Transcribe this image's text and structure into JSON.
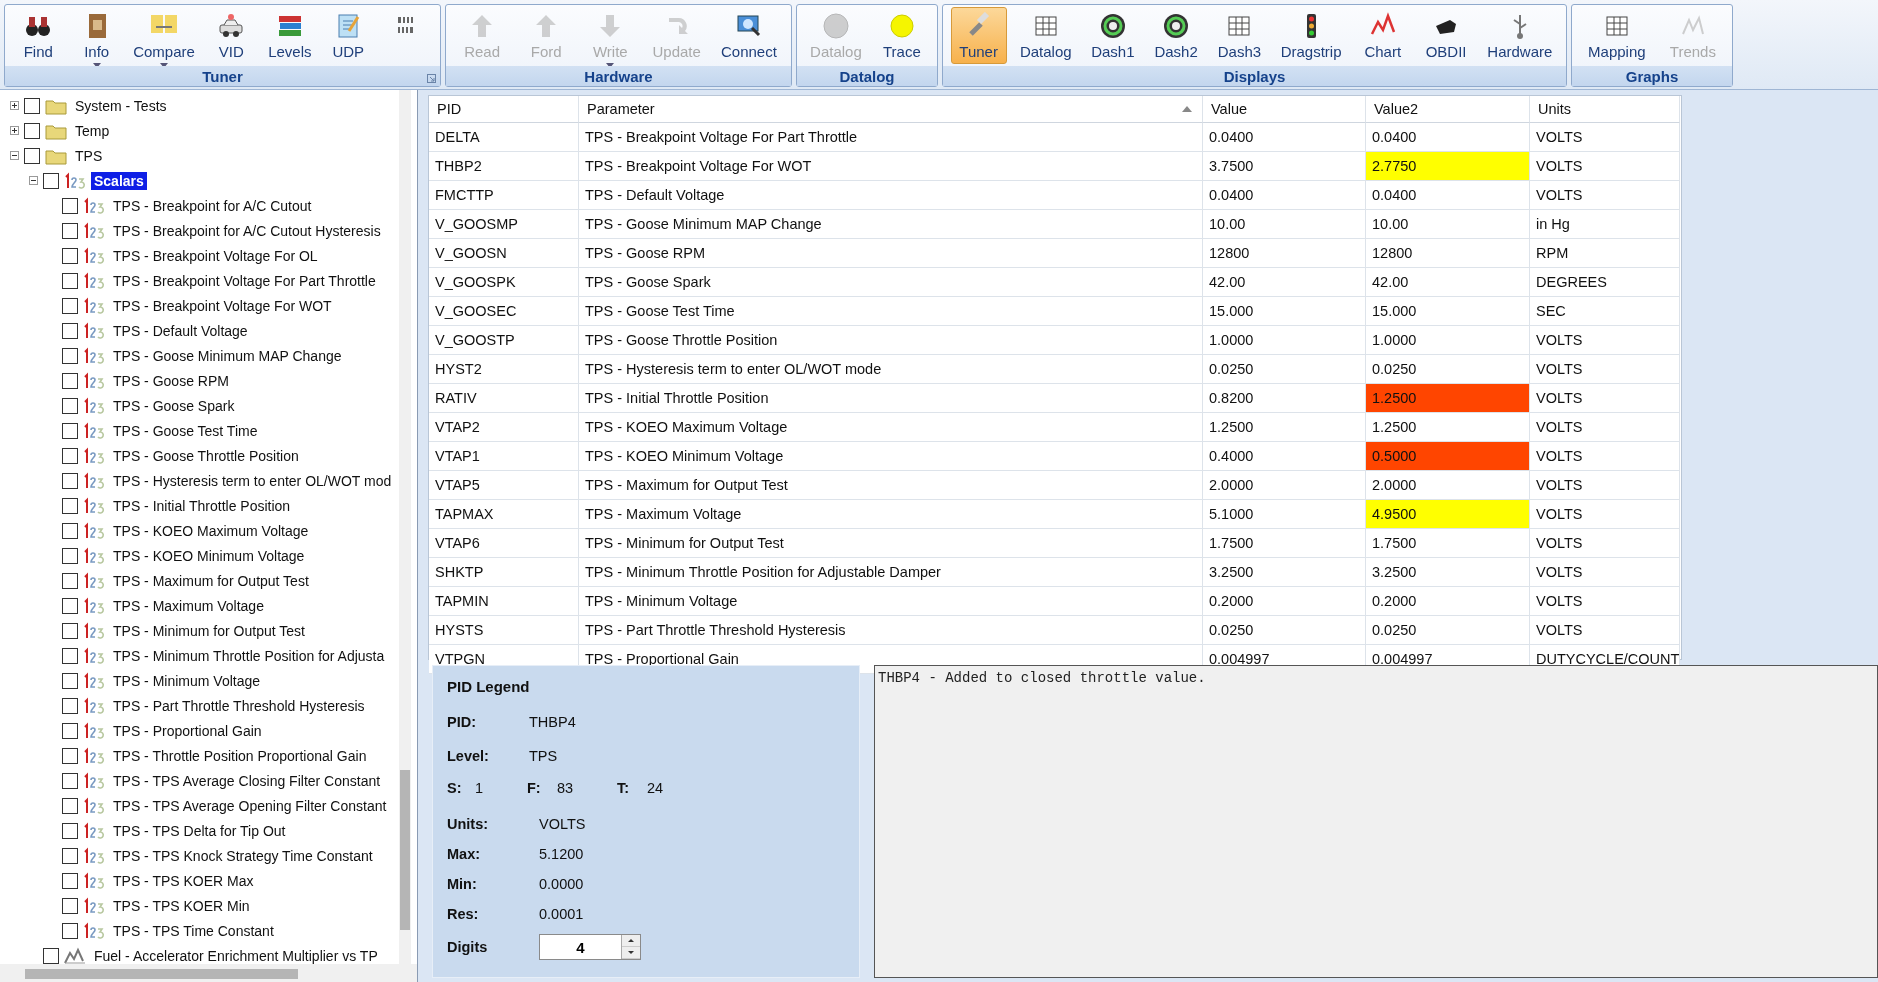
{
  "toolbar": {
    "groups": [
      {
        "title": "Tuner",
        "dialog_launcher": true,
        "buttons": [
          {
            "label": "Find",
            "disabled": false,
            "selected": false,
            "dropdown": false
          },
          {
            "label": "Info",
            "disabled": false,
            "selected": false,
            "dropdown": true
          },
          {
            "label": "Compare",
            "disabled": false,
            "selected": false,
            "dropdown": true
          },
          {
            "label": "VID",
            "disabled": false,
            "selected": false,
            "dropdown": false
          },
          {
            "label": "Levels",
            "disabled": false,
            "selected": false,
            "dropdown": false
          },
          {
            "label": "UDP",
            "disabled": false,
            "selected": false,
            "dropdown": false
          },
          {
            "disabled": false,
            "selected": false,
            "dropdown": false
          }
        ]
      },
      {
        "title": "Hardware",
        "dialog_launcher": false,
        "buttons": [
          {
            "label": "Read",
            "disabled": true,
            "selected": false,
            "dropdown": false
          },
          {
            "label": "Ford",
            "disabled": true,
            "selected": false,
            "dropdown": false
          },
          {
            "label": "Write",
            "disabled": true,
            "selected": false,
            "dropdown": true
          },
          {
            "label": "Update",
            "disabled": true,
            "selected": false,
            "dropdown": false
          },
          {
            "label": "Connect",
            "disabled": false,
            "selected": false,
            "dropdown": false
          }
        ]
      },
      {
        "title": "Datalog",
        "dialog_launcher": false,
        "buttons": [
          {
            "label": "Datalog",
            "disabled": true,
            "selected": false,
            "dropdown": false
          },
          {
            "label": "Trace",
            "disabled": false,
            "selected": false,
            "dropdown": false
          }
        ]
      },
      {
        "title": "Displays",
        "dialog_launcher": false,
        "buttons": [
          {
            "label": "Tuner",
            "disabled": false,
            "selected": true,
            "dropdown": false
          },
          {
            "label": "Datalog",
            "disabled": false,
            "selected": false,
            "dropdown": false
          },
          {
            "label": "Dash1",
            "disabled": false,
            "selected": false,
            "dropdown": false
          },
          {
            "label": "Dash2",
            "disabled": false,
            "selected": false,
            "dropdown": false
          },
          {
            "label": "Dash3",
            "disabled": false,
            "selected": false,
            "dropdown": false
          },
          {
            "label": "Dragstrip",
            "disabled": false,
            "selected": false,
            "dropdown": false
          },
          {
            "label": "Chart",
            "disabled": false,
            "selected": false,
            "dropdown": false
          },
          {
            "label": "OBDII",
            "disabled": false,
            "selected": false,
            "dropdown": false
          },
          {
            "label": "Hardware",
            "disabled": false,
            "selected": false,
            "dropdown": false
          }
        ]
      },
      {
        "title": "Graphs",
        "dialog_launcher": false,
        "buttons": [
          {
            "label": "Mapping",
            "disabled": false,
            "selected": false,
            "dropdown": false
          },
          {
            "label": "Trends",
            "disabled": true,
            "selected": false,
            "dropdown": false
          }
        ]
      }
    ]
  },
  "tree": {
    "items": [
      {
        "label": "System - Tests",
        "kind": "folder",
        "checked": false,
        "selected": false,
        "expanded": false
      },
      {
        "label": "Temp",
        "kind": "folder",
        "checked": false,
        "selected": false,
        "expanded": false
      },
      {
        "label": "TPS",
        "kind": "folder",
        "checked": false,
        "selected": false,
        "expanded": true,
        "children": [
          {
            "label": "Scalars",
            "kind": "number",
            "checked": false,
            "selected": true,
            "expanded": true,
            "children": [
              {
                "label": "TPS - Breakpoint for A/C Cutout",
                "kind": "number",
                "checked": false,
                "selected": false
              },
              {
                "label": "TPS - Breakpoint for A/C Cutout Hysteresis",
                "kind": "number",
                "checked": false,
                "selected": false
              },
              {
                "label": "TPS - Breakpoint Voltage For OL",
                "kind": "number",
                "checked": false,
                "selected": false
              },
              {
                "label": "TPS - Breakpoint Voltage For Part Throttle",
                "kind": "number",
                "checked": false,
                "selected": false
              },
              {
                "label": "TPS - Breakpoint Voltage For WOT",
                "kind": "number",
                "checked": false,
                "selected": false
              },
              {
                "label": "TPS - Default Voltage",
                "kind": "number",
                "checked": false,
                "selected": false
              },
              {
                "label": "TPS - Goose Minimum MAP Change",
                "kind": "number",
                "checked": false,
                "selected": false
              },
              {
                "label": "TPS - Goose RPM",
                "kind": "number",
                "checked": false,
                "selected": false
              },
              {
                "label": "TPS - Goose Spark",
                "kind": "number",
                "checked": false,
                "selected": false
              },
              {
                "label": "TPS - Goose Test Time",
                "kind": "number",
                "checked": false,
                "selected": false
              },
              {
                "label": "TPS - Goose Throttle Position",
                "kind": "number",
                "checked": false,
                "selected": false
              },
              {
                "label": "TPS - Hysteresis term to enter OL/WOT mod",
                "kind": "number",
                "checked": false,
                "selected": false
              },
              {
                "label": "TPS - Initial Throttle Position",
                "kind": "number",
                "checked": false,
                "selected": false
              },
              {
                "label": "TPS - KOEO Maximum Voltage",
                "kind": "number",
                "checked": false,
                "selected": false
              },
              {
                "label": "TPS - KOEO Minimum Voltage",
                "kind": "number",
                "checked": false,
                "selected": false
              },
              {
                "label": "TPS - Maximum for Output Test",
                "kind": "number",
                "checked": false,
                "selected": false
              },
              {
                "label": "TPS - Maximum Voltage",
                "kind": "number",
                "checked": false,
                "selected": false
              },
              {
                "label": "TPS - Minimum for Output Test",
                "kind": "number",
                "checked": false,
                "selected": false
              },
              {
                "label": "TPS - Minimum Throttle Position for Adjusta",
                "kind": "number",
                "checked": false,
                "selected": false
              },
              {
                "label": "TPS - Minimum Voltage",
                "kind": "number",
                "checked": false,
                "selected": false
              },
              {
                "label": "TPS - Part Throttle Threshold Hysteresis",
                "kind": "number",
                "checked": false,
                "selected": false
              },
              {
                "label": "TPS - Proportional Gain",
                "kind": "number",
                "checked": false,
                "selected": false
              },
              {
                "label": "TPS - Throttle Position Proportional Gain",
                "kind": "number",
                "checked": false,
                "selected": false
              },
              {
                "label": "TPS - TPS Average Closing Filter Constant",
                "kind": "number",
                "checked": false,
                "selected": false
              },
              {
                "label": "TPS - TPS Average Opening Filter Constant",
                "kind": "number",
                "checked": false,
                "selected": false
              },
              {
                "label": "TPS - TPS Delta for Tip Out",
                "kind": "number",
                "checked": false,
                "selected": false
              },
              {
                "label": "TPS - TPS Knock Strategy Time Constant",
                "kind": "number",
                "checked": false,
                "selected": false
              },
              {
                "label": "TPS - TPS KOER Max",
                "kind": "number",
                "checked": false,
                "selected": false
              },
              {
                "label": "TPS - TPS KOER Min",
                "kind": "number",
                "checked": false,
                "selected": false
              },
              {
                "label": "TPS - TPS Time Constant",
                "kind": "number",
                "checked": false,
                "selected": false
              }
            ]
          },
          {
            "label": "Fuel - Accelerator Enrichment Multiplier vs TP",
            "kind": "table",
            "checked": false,
            "selected": false
          }
        ]
      }
    ]
  },
  "table": {
    "columns": [
      {
        "label": "PID",
        "sorted": false
      },
      {
        "label": "Parameter",
        "sorted": true
      },
      {
        "label": "Value",
        "sorted": false
      },
      {
        "label": "Value2",
        "sorted": false
      },
      {
        "label": "Units",
        "sorted": false
      }
    ],
    "rows": [
      {
        "pid": "DELTA",
        "parameter": "TPS - Breakpoint Voltage For Part Throttle",
        "value": "0.0400",
        "value2": "0.0400",
        "units": "VOLTS"
      },
      {
        "pid": "THBP2",
        "parameter": "TPS - Breakpoint Voltage For WOT",
        "value": "3.7500",
        "value2": "2.7750",
        "units": "VOLTS",
        "color": "#ffff00"
      },
      {
        "pid": "FMCTTP",
        "parameter": "TPS - Default Voltage",
        "value": "0.0400",
        "value2": "0.0400",
        "units": "VOLTS"
      },
      {
        "pid": "V_GOOSMP",
        "parameter": "TPS - Goose Minimum MAP Change",
        "value": "10.00",
        "value2": "10.00",
        "units": "in Hg"
      },
      {
        "pid": "V_GOOSN",
        "parameter": "TPS - Goose RPM",
        "value": "12800",
        "value2": "12800",
        "units": "RPM"
      },
      {
        "pid": "V_GOOSPK",
        "parameter": "TPS - Goose Spark",
        "value": "42.00",
        "value2": "42.00",
        "units": "DEGREES"
      },
      {
        "pid": "V_GOOSEC",
        "parameter": "TPS - Goose Test Time",
        "value": "15.000",
        "value2": "15.000",
        "units": "SEC"
      },
      {
        "pid": "V_GOOSTP",
        "parameter": "TPS - Goose Throttle Position",
        "value": "1.0000",
        "value2": "1.0000",
        "units": "VOLTS"
      },
      {
        "pid": "HYST2",
        "parameter": "TPS - Hysteresis term to enter OL/WOT mode",
        "value": "0.0250",
        "value2": "0.0250",
        "units": "VOLTS"
      },
      {
        "pid": "RATIV",
        "parameter": "TPS - Initial Throttle Position",
        "value": "0.8200",
        "value2": "1.2500",
        "units": "VOLTS",
        "color": "#ff4500"
      },
      {
        "pid": "VTAP2",
        "parameter": "TPS - KOEO Maximum Voltage",
        "value": "1.2500",
        "value2": "1.2500",
        "units": "VOLTS"
      },
      {
        "pid": "VTAP1",
        "parameter": "TPS - KOEO Minimum Voltage",
        "value": "0.4000",
        "value2": "0.5000",
        "units": "VOLTS",
        "color": "#ff4500"
      },
      {
        "pid": "VTAP5",
        "parameter": "TPS - Maximum for Output Test",
        "value": "2.0000",
        "value2": "2.0000",
        "units": "VOLTS"
      },
      {
        "pid": "TAPMAX",
        "parameter": "TPS - Maximum Voltage",
        "value": "5.1000",
        "value2": "4.9500",
        "units": "VOLTS",
        "color": "#ffff00"
      },
      {
        "pid": "VTAP6",
        "parameter": "TPS - Minimum for Output Test",
        "value": "1.7500",
        "value2": "1.7500",
        "units": "VOLTS"
      },
      {
        "pid": "SHKTP",
        "parameter": "TPS - Minimum Throttle Position for Adjustable Damper",
        "value": "3.2500",
        "value2": "3.2500",
        "units": "VOLTS"
      },
      {
        "pid": "TAPMIN",
        "parameter": "TPS - Minimum Voltage",
        "value": "0.2000",
        "value2": "0.2000",
        "units": "VOLTS"
      },
      {
        "pid": "HYSTS",
        "parameter": "TPS - Part Throttle Threshold Hysteresis",
        "value": "0.0250",
        "value2": "0.0250",
        "units": "VOLTS"
      },
      {
        "pid": "VTPGN",
        "parameter": "TPS - Proportional Gain",
        "value": "0.004997",
        "value2": "0.004997",
        "units": "DUTYCYCLE/COUNT"
      }
    ]
  },
  "legend": {
    "title": "PID Legend",
    "top_fields": [
      {
        "label": "PID:",
        "value": "THBP4"
      },
      {
        "label": "Level:",
        "value": "TPS"
      }
    ],
    "counts": [
      {
        "label": "S:",
        "value": "1"
      },
      {
        "label": "F:",
        "value": "83"
      },
      {
        "label": "T:",
        "value": "24"
      }
    ],
    "fields": [
      {
        "label": "Units:",
        "value": "VOLTS"
      },
      {
        "label": "Max:",
        "value": "5.1200"
      },
      {
        "label": "Min:",
        "value": "0.0000"
      },
      {
        "label": "Res:",
        "value": "0.0001"
      }
    ],
    "digits": {
      "label": "Digits",
      "value": "4"
    }
  },
  "description": "THBP4 - Added to closed throttle value."
}
